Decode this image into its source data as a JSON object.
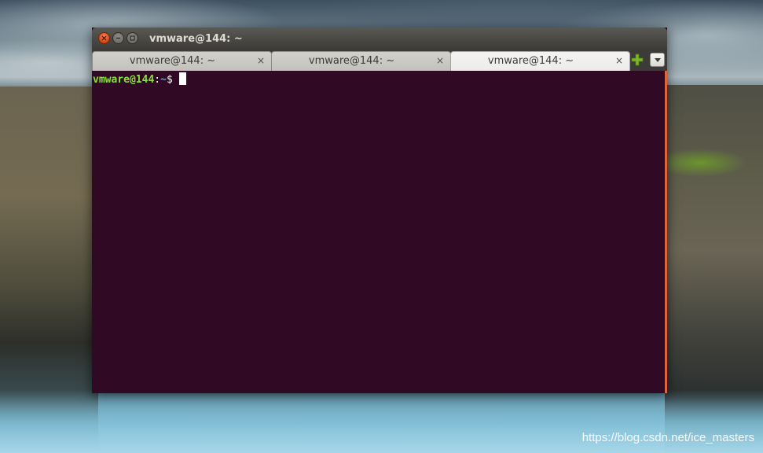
{
  "window": {
    "title": "vmware@144: ~"
  },
  "tabs": [
    {
      "label": "vmware@144: ~",
      "close": "×",
      "active": false
    },
    {
      "label": "vmware@144: ~",
      "close": "×",
      "active": false
    },
    {
      "label": "vmware@144: ~",
      "close": "×",
      "active": true
    }
  ],
  "terminal": {
    "prompt_user_host": "vmware@144",
    "prompt_sep": ":",
    "prompt_dir": "~",
    "prompt_symbol": "$"
  },
  "icons": {
    "close": "close-icon",
    "minimize": "minimize-icon",
    "maximize": "maximize-icon",
    "new_tab": "plus-icon",
    "tab_menu": "chevron-down-icon"
  },
  "colors": {
    "terminal_bg": "#300a24",
    "prompt_user": "#8ae234",
    "prompt_dir": "#729fcf",
    "close_button": "#df4a16",
    "new_tab_plus": "#7ab82a"
  },
  "watermark": "https://blog.csdn.net/ice_masters"
}
